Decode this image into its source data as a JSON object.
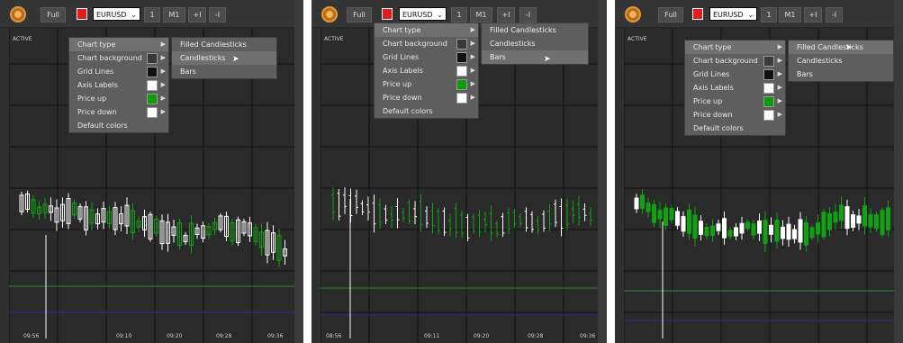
{
  "toolbar": {
    "full_label": "Full",
    "symbol": "EURUSD",
    "one_label": "1",
    "timeframe": "M1",
    "zoom_in": "+I",
    "zoom_out": "-I",
    "color_swatch": "#e31b1b"
  },
  "chart": {
    "active_label": "ACTIVE",
    "background": "#2a2a2a",
    "grid_color": "#101010",
    "price_up_color": "#11a112",
    "price_down_color": "#ffffff",
    "green_line_color": "#2c8a2c",
    "blue_line_color": "#2a2a9a"
  },
  "menu": {
    "items": [
      {
        "label": "Chart type"
      },
      {
        "label": "Chart background"
      },
      {
        "label": "Grid Lines"
      },
      {
        "label": "Axis Labels"
      },
      {
        "label": "Price up"
      },
      {
        "label": "Price down"
      },
      {
        "label": "Default colors"
      }
    ],
    "submenu": [
      {
        "label": "Filled Candlesticks"
      },
      {
        "label": "Candlesticks"
      },
      {
        "label": "Bars"
      }
    ]
  },
  "panels": [
    {
      "times": [
        "09:56",
        "09:10",
        "09:20",
        "09:28",
        "09:36"
      ]
    },
    {
      "times": [
        "08:56",
        "09:11",
        "09:20",
        "09:28",
        "09:36"
      ]
    },
    {
      "times": []
    }
  ]
}
